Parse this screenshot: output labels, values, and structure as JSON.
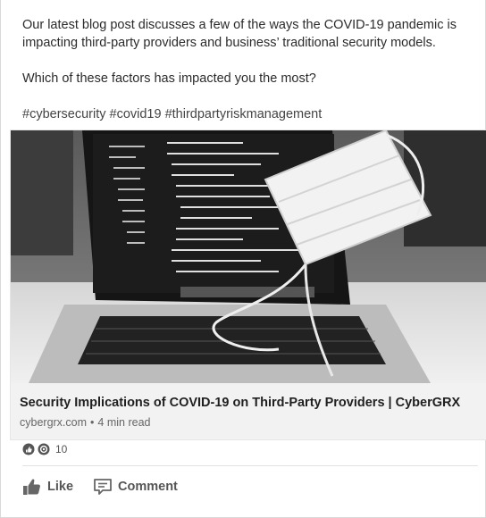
{
  "post": {
    "paragraph1": "Our latest blog post discusses a few of the ways the COVID-19 pandemic is impacting third-party providers and business’ traditional security models.",
    "paragraph2": "Which of these factors has impacted you the most?",
    "hashtags": "#cybersecurity #covid19 #thirdpartyriskmanagement"
  },
  "article": {
    "title": "Security Implications of COVID-19 on Third-Party Providers | CyberGRX",
    "source": "cybergrx.com",
    "read_time": "4 min read",
    "image_icons": [
      "laptop-photo",
      "face-mask-photo"
    ]
  },
  "social": {
    "reaction_icons": [
      "like-reaction-icon",
      "celebrate-reaction-icon"
    ],
    "reaction_count": "10",
    "like_label": "Like",
    "comment_label": "Comment"
  }
}
